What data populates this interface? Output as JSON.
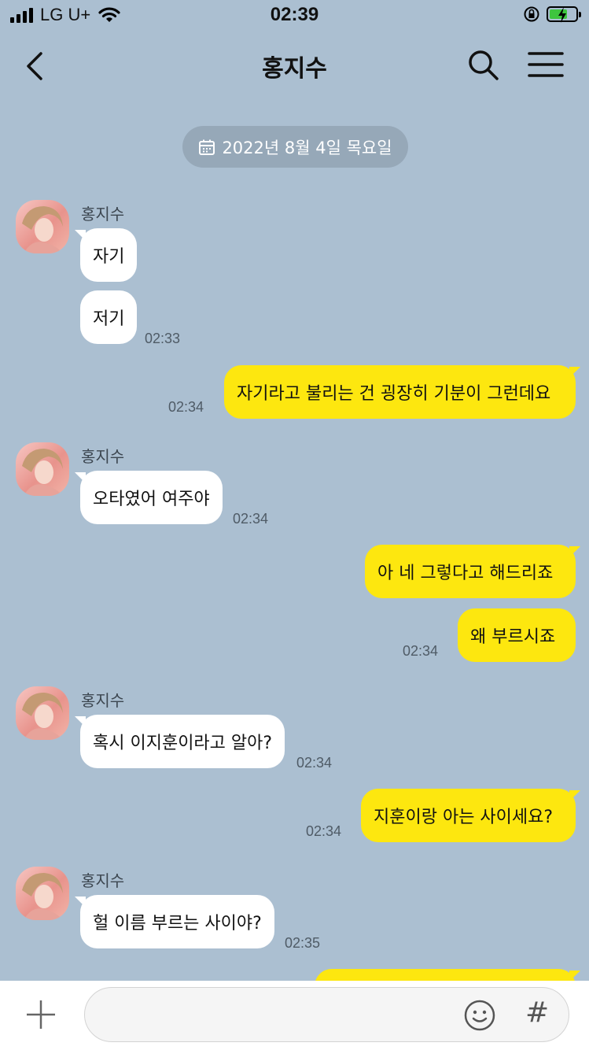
{
  "status_bar": {
    "carrier": "LG U+",
    "time": "02:39"
  },
  "header": {
    "title": "홍지수"
  },
  "date_divider": "2022년 8월 4일 목요일",
  "messages": [
    {
      "from": "홍지수",
      "text": "자기"
    },
    {
      "from": "홍지수",
      "text": "저기",
      "time": "02:33"
    },
    {
      "from": "me",
      "text": "자기라고 불리는 건 굉장히 기분이 그런데요",
      "time": "02:34"
    },
    {
      "from": "홍지수",
      "text": "오타였어 여주야",
      "time": "02:34"
    },
    {
      "from": "me",
      "text": "아 네 그렇다고 해드리죠"
    },
    {
      "from": "me",
      "text": "왜 부르시죠",
      "time": "02:34"
    },
    {
      "from": "홍지수",
      "text": "혹시 이지훈이라고 알아?",
      "time": "02:34"
    },
    {
      "from": "me",
      "text": "지훈이랑 아는 사이세요?",
      "time": "02:34"
    },
    {
      "from": "홍지수",
      "text": "헐 이름 부르는 사이야?",
      "time": "02:35"
    }
  ],
  "sender_name": "홍지수",
  "input": {
    "placeholder": "",
    "emoji_icon": "emoji-icon",
    "hash_label": "#"
  },
  "colors": {
    "background": "#abbfd1",
    "my_bubble": "#fde70f",
    "their_bubble": "#ffffff"
  }
}
